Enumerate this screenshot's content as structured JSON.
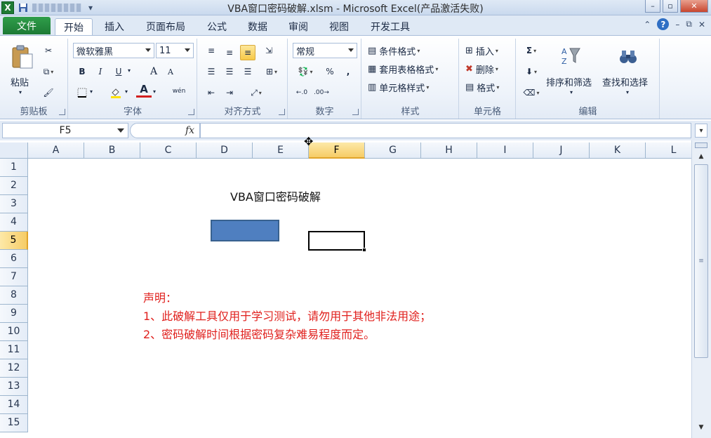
{
  "window": {
    "title": "VBA窗口密码破解.xlsm - Microsoft Excel(产品激活失败)",
    "app_icon_text": "X",
    "controls": {
      "minimize": "–",
      "restore": "▫",
      "close": "✕"
    }
  },
  "ribbon_tabs": [
    {
      "label": "文件"
    },
    {
      "label": "开始",
      "active": true
    },
    {
      "label": "插入"
    },
    {
      "label": "页面布局"
    },
    {
      "label": "公式"
    },
    {
      "label": "数据"
    },
    {
      "label": "审阅"
    },
    {
      "label": "视图"
    },
    {
      "label": "开发工具"
    }
  ],
  "ribbon": {
    "clipboard": {
      "group_label": "剪贴板",
      "paste_label": "粘贴"
    },
    "font": {
      "group_label": "字体",
      "font_name": "微软雅黑",
      "font_size": "11",
      "bold": "B",
      "italic": "I",
      "underline": "U",
      "grow": "A",
      "shrink": "A",
      "font_color_glyph": "A",
      "phonetic": "wén"
    },
    "alignment": {
      "group_label": "对齐方式"
    },
    "number": {
      "group_label": "数字",
      "format": "常规",
      "percent": "%",
      "comma": ","
    },
    "styles": {
      "group_label": "样式",
      "conditional": "条件格式",
      "table": "套用表格格式",
      "cell_styles": "单元格样式"
    },
    "cells": {
      "group_label": "单元格",
      "insert": "插入",
      "delete": "删除",
      "format": "格式"
    },
    "editing": {
      "group_label": "编辑",
      "sigma": "Σ",
      "sort_filter": "排序和筛选",
      "find_select": "查找和选择"
    }
  },
  "formula_bar": {
    "name_box": "F5",
    "fx_label": "fx",
    "formula": ""
  },
  "columns": [
    "A",
    "B",
    "C",
    "D",
    "E",
    "F",
    "G",
    "H",
    "I",
    "J",
    "K",
    "L"
  ],
  "selected_column": "F",
  "rows": [
    "1",
    "2",
    "3",
    "4",
    "5",
    "6",
    "7",
    "8",
    "9",
    "10",
    "11",
    "12",
    "13",
    "14",
    "15"
  ],
  "selected_row": "5",
  "sheet": {
    "title": "VBA窗口密码破解",
    "notice_lines": [
      "声明：",
      "1、此破解工具仅用于学习测试，请勿用于其他非法用途；",
      "2、密码破解时间根据密码复杂难易程度而定。"
    ],
    "button_color": "#4f7fc0",
    "notice_color": "#e0201d"
  }
}
